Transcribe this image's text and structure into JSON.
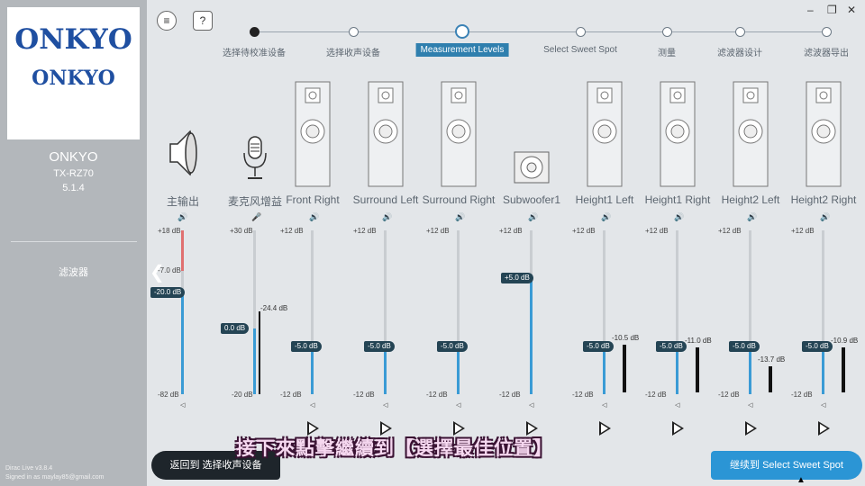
{
  "sidebar": {
    "logo_line1": "ONKYO",
    "logo_line2": "ONKYO",
    "brand": "ONKYO",
    "model": "TX-RZ70",
    "config": "5.1.4",
    "filter": "滤波器",
    "footer_version": "Dirac Live v3.8.4",
    "footer_signed": "Signed in as maylay85@gmail.com"
  },
  "header": {
    "menu_icon": "≡",
    "help_icon": "?",
    "window_controls": [
      "–",
      "❐",
      "✕"
    ]
  },
  "steps": [
    {
      "label": "选择待校准设备",
      "state": "done"
    },
    {
      "label": "选择收声设备",
      "state": "todo"
    },
    {
      "label": "Measurement Levels",
      "state": "active"
    },
    {
      "label": "Select Sweet Spot",
      "state": "todo"
    },
    {
      "label": "测量",
      "state": "todo"
    },
    {
      "label": "滤波器设计",
      "state": "todo"
    },
    {
      "label": "滤波器导出",
      "state": "todo"
    }
  ],
  "main_output": {
    "label": "主输出",
    "top_tick": "+18 dB",
    "mid_tick": "-7.0 dB",
    "bottom_tick": "-82 dB",
    "value": "-20.0 dB"
  },
  "mic_gain": {
    "label": "麦克风增益",
    "top_tick": "+30 dB",
    "bottom_tick": "-20 dB",
    "value": "0.0 dB",
    "meter": "-24.4 dB"
  },
  "channels": [
    {
      "name": "Front Right",
      "value": "-5.0 dB",
      "meter": "",
      "top_tick": "+12 dB",
      "bottom_tick": "-12 dB"
    },
    {
      "name": "Surround Left",
      "value": "-5.0 dB",
      "meter": "",
      "top_tick": "+12 dB",
      "bottom_tick": "-12 dB"
    },
    {
      "name": "Surround Right",
      "value": "-5.0 dB",
      "meter": "",
      "top_tick": "+12 dB",
      "bottom_tick": "-12 dB"
    },
    {
      "name": "Subwoofer1",
      "value": "+5.0 dB",
      "meter": "",
      "top_tick": "+12 dB",
      "bottom_tick": "-12 dB"
    },
    {
      "name": "Height1 Left",
      "value": "-5.0 dB",
      "meter": "-10.5 dB",
      "top_tick": "+12 dB",
      "bottom_tick": "-12 dB"
    },
    {
      "name": "Height1 Right",
      "value": "-5.0 dB",
      "meter": "-11.0 dB",
      "top_tick": "+12 dB",
      "bottom_tick": "-12 dB"
    },
    {
      "name": "Height2 Left",
      "value": "-5.0 dB",
      "meter": "-13.7 dB",
      "top_tick": "+12 dB",
      "bottom_tick": "-12 dB"
    },
    {
      "name": "Height2 Right",
      "value": "-5.0 dB",
      "meter": "-10.9 dB",
      "top_tick": "+12 dB",
      "bottom_tick": "-12 dB"
    }
  ],
  "footer": {
    "back_label": "返回到 选择收声设备",
    "next_label": "继续到 Select Sweet Spot",
    "subtitle": "接下來點擊繼續到【選擇最佳位置】"
  },
  "colors": {
    "accent": "#2b95d5",
    "knob": "#244454",
    "sidebar": "#b3b7bb",
    "logo_blue": "#1f4fa1"
  }
}
